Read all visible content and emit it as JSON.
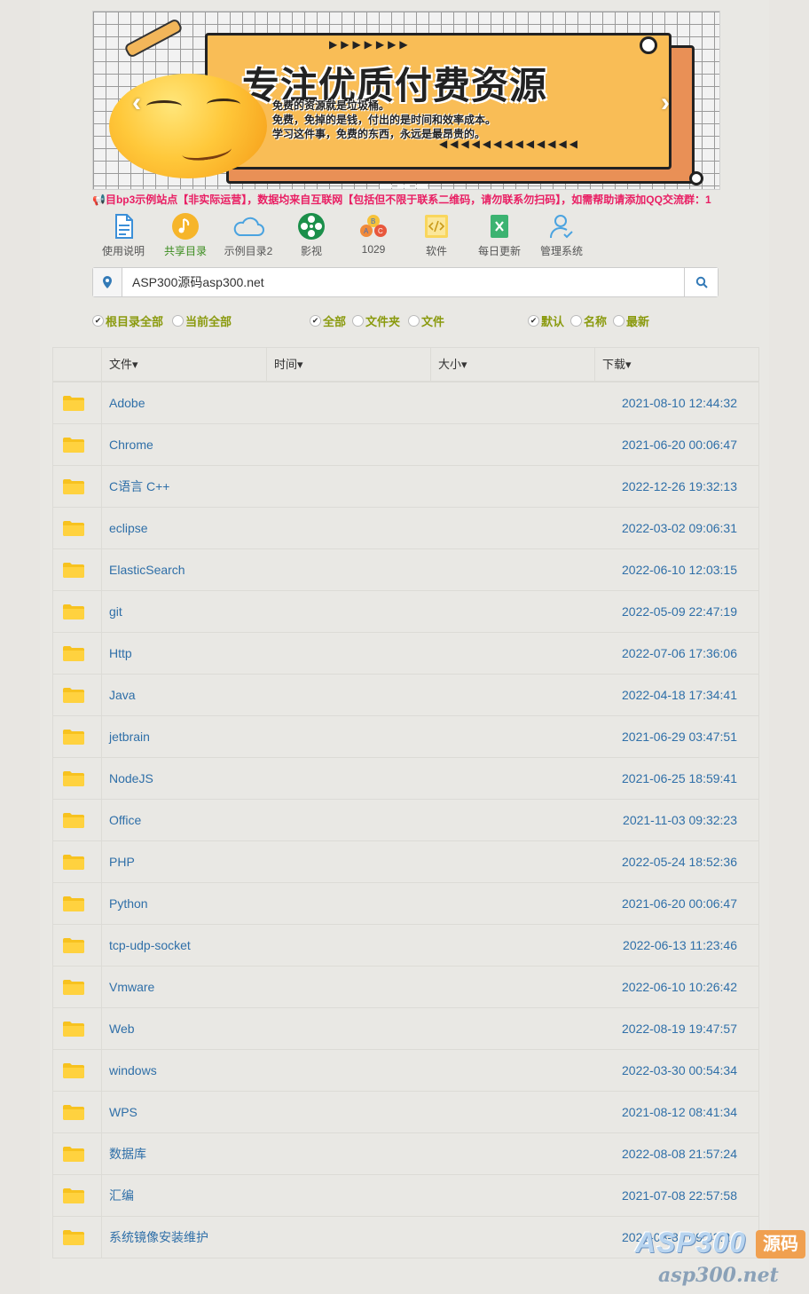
{
  "banner": {
    "title": "专注优质付费资源",
    "line1": "免费的资源就是垃圾桶。",
    "line2": "免费，免掉的是钱，付出的是时间和效率成本。",
    "line3": "学习这件事，免费的东西，永远是最昂贵的。",
    "prev": "‹",
    "next": "›"
  },
  "notice": "📢目bp3示例站点【非实际运营】，数据均来自互联网【包括但不限于联系二维码，请勿联系勿扫码】，如需帮助请添加QQ交流群：1",
  "nav": [
    {
      "label": "使用说明",
      "icon": "document-icon"
    },
    {
      "label": "共享目录",
      "icon": "music-note-icon"
    },
    {
      "label": "示例目录2",
      "icon": "cloud-icon"
    },
    {
      "label": "影视",
      "icon": "film-reel-icon"
    },
    {
      "label": "1029",
      "icon": "abc-balls-icon"
    },
    {
      "label": "软件",
      "icon": "code-icon"
    },
    {
      "label": "每日更新",
      "icon": "excel-icon"
    },
    {
      "label": "管理系统",
      "icon": "user-check-icon"
    }
  ],
  "search": {
    "value": "ASP300源码asp300.net"
  },
  "filters": {
    "scope_all": "根目录全部",
    "scope_current": "当前全部",
    "type_all": "全部",
    "type_folder": "文件夹",
    "type_file": "文件",
    "sort_default": "默认",
    "sort_name": "名称",
    "sort_new": "最新"
  },
  "table": {
    "headers": [
      "文件",
      "时间",
      "大小",
      "下载"
    ],
    "rows": [
      {
        "name": "Adobe",
        "time": "2021-08-10 12:44:32"
      },
      {
        "name": "Chrome",
        "time": "2021-06-20 00:06:47"
      },
      {
        "name": "C语言 C++",
        "time": "2022-12-26 19:32:13"
      },
      {
        "name": "eclipse",
        "time": "2022-03-02 09:06:31"
      },
      {
        "name": "ElasticSearch",
        "time": "2022-06-10 12:03:15"
      },
      {
        "name": "git",
        "time": "2022-05-09 22:47:19"
      },
      {
        "name": "Http",
        "time": "2022-07-06 17:36:06"
      },
      {
        "name": "Java",
        "time": "2022-04-18 17:34:41"
      },
      {
        "name": "jetbrain",
        "time": "2021-06-29 03:47:51"
      },
      {
        "name": "NodeJS",
        "time": "2021-06-25 18:59:41"
      },
      {
        "name": "Office",
        "time": "2021-11-03 09:32:23"
      },
      {
        "name": "PHP",
        "time": "2022-05-24 18:52:36"
      },
      {
        "name": "Python",
        "time": "2021-06-20 00:06:47"
      },
      {
        "name": "tcp-udp-socket",
        "time": "2022-06-13 11:23:46"
      },
      {
        "name": "Vmware",
        "time": "2022-06-10 10:26:42"
      },
      {
        "name": "Web",
        "time": "2022-08-19 19:47:57"
      },
      {
        "name": "windows",
        "time": "2022-03-30 00:54:34"
      },
      {
        "name": "WPS",
        "time": "2021-08-12 08:41:34"
      },
      {
        "name": "数据库",
        "time": "2022-08-08 21:57:24"
      },
      {
        "name": "汇编",
        "time": "2021-07-08 22:57:58"
      },
      {
        "name": "系统镜像安装维护",
        "time": "2022-08-30 09:43:24"
      }
    ]
  },
  "watermark": {
    "logo": "ASP300",
    "tag": "源码",
    "url": "asp300.net"
  },
  "colors": {
    "link": "#2f6fa8",
    "notice": "#e91e63",
    "filter": "#8a9a0e",
    "folder": "#f7c21f"
  }
}
